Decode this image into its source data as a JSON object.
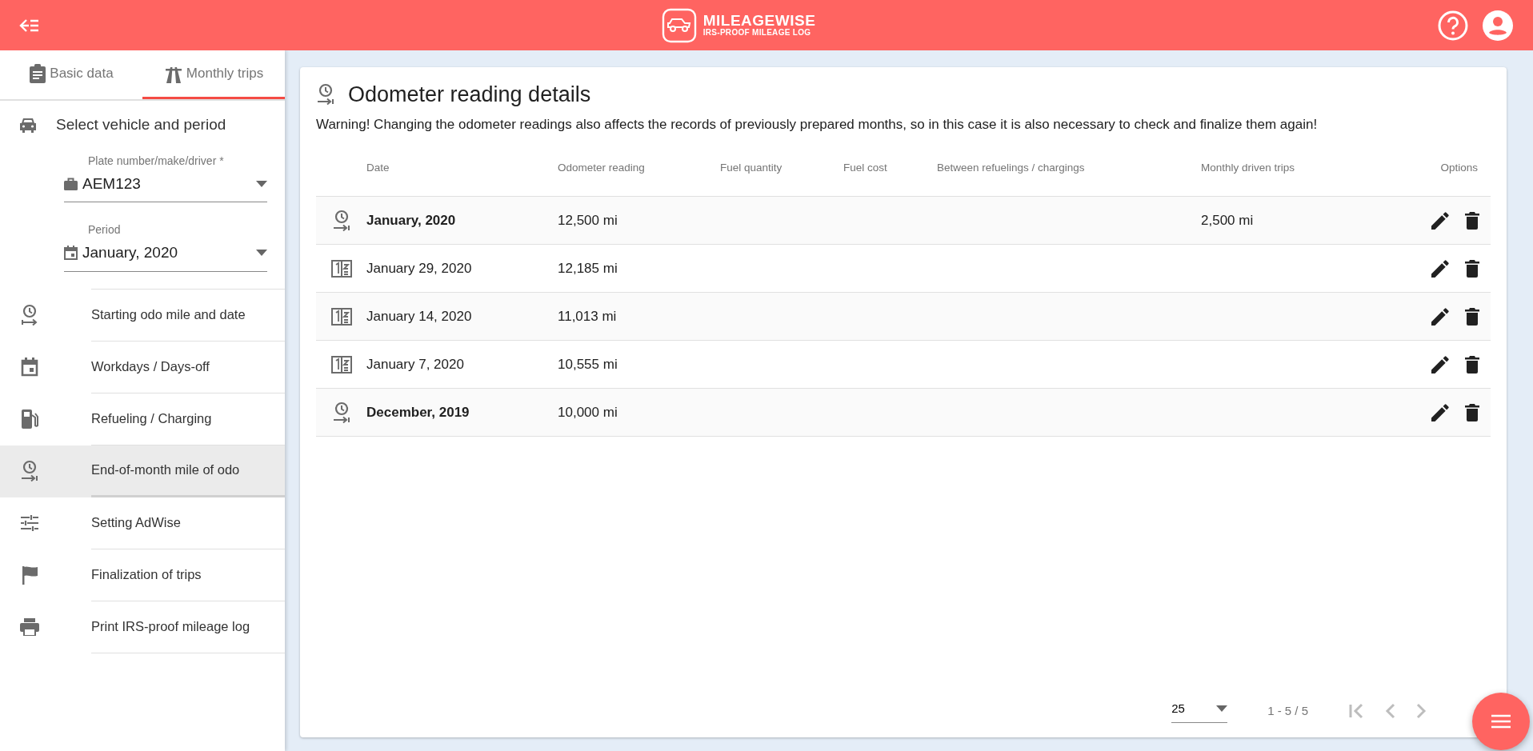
{
  "header": {
    "logo_title": "MILEAGEWISE",
    "logo_subtitle": "IRS-PROOF MILEAGE LOG"
  },
  "sidebar": {
    "tabs": [
      {
        "label": "Basic data",
        "selected": false
      },
      {
        "label": "Monthly trips",
        "selected": true
      }
    ],
    "section_title": "Select vehicle and period",
    "fields": [
      {
        "label": "Plate number/make/driver *",
        "value": "AEM123"
      },
      {
        "label": "Period",
        "value": "January, 2020"
      }
    ],
    "items": [
      {
        "label": "Starting odo mile and date",
        "selected": false
      },
      {
        "label": "Workdays / Days-off",
        "selected": false
      },
      {
        "label": "Refueling / Charging",
        "selected": false
      },
      {
        "label": "End-of-month mile of odo",
        "selected": true
      },
      {
        "label": "Setting AdWise",
        "selected": false
      },
      {
        "label": "Finalization of trips",
        "selected": false
      },
      {
        "label": "Print IRS-proof mileage log",
        "selected": false
      }
    ]
  },
  "main": {
    "title": "Odometer reading details",
    "warning": "Warning! Changing the odometer readings also affects the records of previously prepared months, so in this case it is also necessary to check and finalize them again!",
    "table": {
      "columns": [
        "Date",
        "Odometer reading",
        "Fuel quantity",
        "Fuel cost",
        "Between refuelings / chargings",
        "Monthly driven trips",
        "Options"
      ],
      "rows": [
        {
          "kind": "monthly",
          "date": "January, 2020",
          "odometer": "12,500 mi",
          "monthly_trips": "2,500 mi"
        },
        {
          "kind": "reading",
          "date": "January 29, 2020",
          "odometer": "12,185 mi"
        },
        {
          "kind": "reading",
          "date": "January 14, 2020",
          "odometer": "11,013 mi"
        },
        {
          "kind": "reading",
          "date": "January 7, 2020",
          "odometer": "10,555 mi"
        },
        {
          "kind": "monthly",
          "date": "December, 2019",
          "odometer": "10,000 mi"
        }
      ]
    },
    "pagination": {
      "per_page": "25",
      "range": "1 - 5 / 5",
      "first_disabled": true,
      "prev_disabled": true,
      "next_disabled": true
    }
  }
}
